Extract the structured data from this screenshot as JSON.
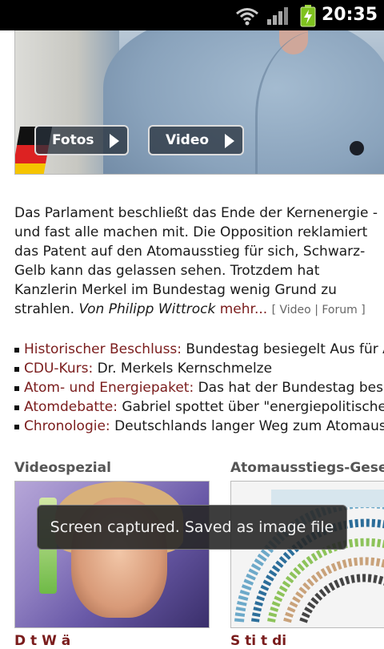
{
  "status_bar": {
    "time": "20:35"
  },
  "hero": {
    "buttons": {
      "fotos": "Fotos",
      "video": "Video"
    }
  },
  "article": {
    "body": "Das Parlament beschließt das Ende der Kernenergie - und fast alle machen mit. Die Opposition reklamiert das Patent auf den Atomausstieg für sich, Schwarz-Gelb kann das gelassen sehen. Trotzdem hat Kanzlerin Merkel im Bundestag wenig Grund zu strahlen.",
    "author": "Von Philipp Wittrock",
    "more_link": "mehr...",
    "meta_open": "[",
    "meta_video": "Video",
    "meta_sep": "|",
    "meta_forum": "Forum",
    "meta_close": "]"
  },
  "bullets": [
    {
      "keyword": "Historischer Beschluss:",
      "text": " Bundestag besiegelt Aus für Ato"
    },
    {
      "keyword": "CDU-Kurs:",
      "text": " Dr. Merkels Kernschmelze"
    },
    {
      "keyword": "Atom- und Energiepaket:",
      "text": " Das hat der Bundestag beschl"
    },
    {
      "keyword": "Atomdebatte:",
      "text": " Gabriel spottet über \"energiepolitisches V"
    },
    {
      "keyword": "Chronologie:",
      "text": " Deutschlands langer Weg zum Atomaussti"
    }
  ],
  "sections": {
    "left_title": "Videospezial",
    "right_title": "Atomausstiegs-Gesetz"
  },
  "bottom_cut": {
    "left": "D    t      W                ä",
    "right": "S    ti          t    di"
  },
  "toast": {
    "message": "Screen captured. Saved as image file"
  }
}
